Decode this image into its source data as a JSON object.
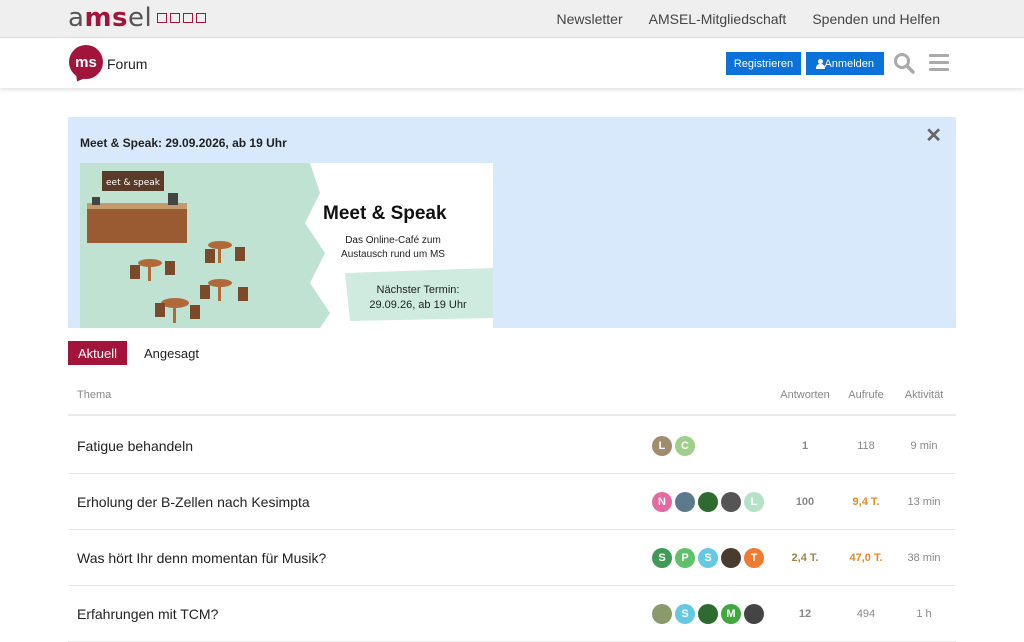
{
  "brand": {
    "text_a": "a",
    "text_ms": "ms",
    "text_el": "el"
  },
  "topnav": [
    "Newsletter",
    "AMSEL-Mitgliedschaft",
    "Spenden und Helfen"
  ],
  "header": {
    "logo_text": "ms",
    "forum_title": "Forum",
    "register_label": "Registrieren",
    "login_label": "Anmelden"
  },
  "banner": {
    "title": "Meet & Speak: 29.09.2026, ab 19 Uhr",
    "close": "✕",
    "promo_title": "Meet & Speak",
    "promo_sub_1": "Das Online-Café zum",
    "promo_sub_2": "Austausch rund um MS",
    "promo_next_1": "Nächster Termin:",
    "promo_next_2": "29.09.26, ab 19 Uhr",
    "sign_text": "eet & speak"
  },
  "tabs": [
    "Aktuell",
    "Angesagt"
  ],
  "table": {
    "headers": {
      "topic": "Thema",
      "replies": "Antworten",
      "views": "Aufrufe",
      "activity": "Aktivität"
    },
    "rows": [
      {
        "title": "Fatigue behandeln",
        "replies": "1",
        "views": "118",
        "activity": "9 min",
        "avatars": [
          {
            "letter": "L",
            "color": "#a38b6d"
          },
          {
            "letter": "C",
            "color": "#9fcf8b"
          }
        ]
      },
      {
        "title": "Erholung der B-Zellen nach Kesimpta",
        "replies": "100",
        "views": "9,4 T.",
        "activity": "13 min",
        "avatars": [
          {
            "letter": "N",
            "color": "#e56aa2"
          },
          {
            "letter": "",
            "color": "#5d7a8c"
          },
          {
            "letter": "",
            "color": "#2e6b2e"
          },
          {
            "letter": "",
            "color": "#555"
          },
          {
            "letter": "L",
            "color": "#b5e2c6"
          }
        ]
      },
      {
        "title": "Was hört Ihr denn momentan für Musik?",
        "replies": "2,4 T.",
        "views": "47,0 T.",
        "activity": "38 min",
        "avatars": [
          {
            "letter": "S",
            "color": "#3f9a55"
          },
          {
            "letter": "P",
            "color": "#5fc16a"
          },
          {
            "letter": "S",
            "color": "#66c9e3"
          },
          {
            "letter": "",
            "color": "#4a3b30"
          },
          {
            "letter": "T",
            "color": "#f07a30"
          }
        ]
      },
      {
        "title": "Erfahrungen mit TCM?",
        "replies": "12",
        "views": "494",
        "activity": "1 h",
        "avatars": [
          {
            "letter": "",
            "color": "#8a9a6b"
          },
          {
            "letter": "S",
            "color": "#66c9e3"
          },
          {
            "letter": "",
            "color": "#2e6b2e"
          },
          {
            "letter": "M",
            "color": "#3fa83f"
          },
          {
            "letter": "",
            "color": "#444"
          }
        ]
      }
    ]
  },
  "colors": {
    "accent": "#a3143a",
    "button": "#0a72d8",
    "banner_bg": "#d9e9fc",
    "hot": "#e48a27"
  }
}
